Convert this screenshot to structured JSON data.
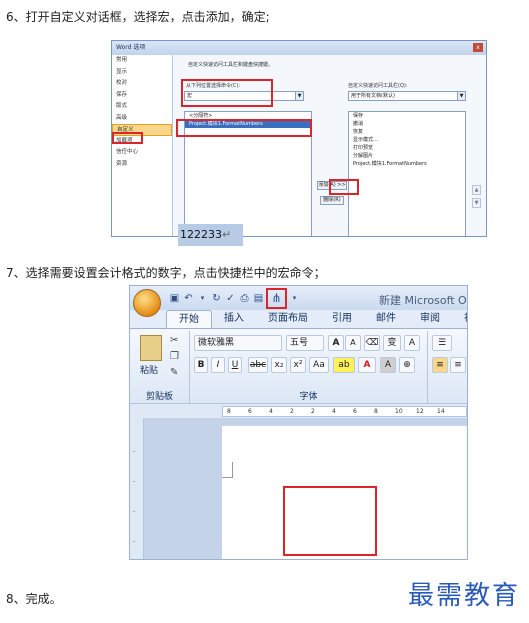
{
  "steps": {
    "s6": "6、打开自定义对话框，选择宏，点击添加，确定;",
    "s7": "7、选择需要设置会计格式的数字，点击快捷栏中的宏命令；",
    "s8": "8、完成。"
  },
  "options_dialog": {
    "title": "Word 选项",
    "close": "x",
    "nav": [
      "常用",
      "显示",
      "校对",
      "保存",
      "版式",
      "高级",
      "自定义",
      "加载项",
      "信任中心",
      "资源"
    ],
    "selected_nav_index": 6,
    "heading": "自定义快速访问工具栏和键盘快捷键。",
    "choose_label": "从下列位置选择命令(C):",
    "choose_value": "宏",
    "customize_label": "自定义快速访问工具栏(Q):",
    "customize_value": "用于所有文档(默认)",
    "left_list": [
      "<分隔符>",
      "Project.模块1.FormatNumbers"
    ],
    "right_list": [
      "保存",
      "撤消",
      "恢复",
      "显示模式...",
      "打印预览",
      "分解图片",
      "Project.模块1.FormatNumbers"
    ],
    "add_button": "添加(A) >>",
    "remove_button": "删除(R)"
  },
  "word_window": {
    "doc_title": "新建 Microsoft Off",
    "tabs": [
      "开始",
      "插入",
      "页面布局",
      "引用",
      "邮件",
      "审阅",
      "视图"
    ],
    "active_tab_index": 0,
    "paste_label": "粘贴",
    "clipboard_group": "剪贴板",
    "font_group": "字体",
    "font_name": "微软雅黑",
    "font_size": "五号",
    "ruler_ticks": [
      "8",
      "6",
      "4",
      "2",
      "2",
      "4",
      "6",
      "8",
      "10",
      "12",
      "14"
    ],
    "cell_value": "122233"
  },
  "logo": "最需教育",
  "colors": {
    "highlight_red": "#d9262b",
    "logo_blue": "#2a5ab8"
  }
}
